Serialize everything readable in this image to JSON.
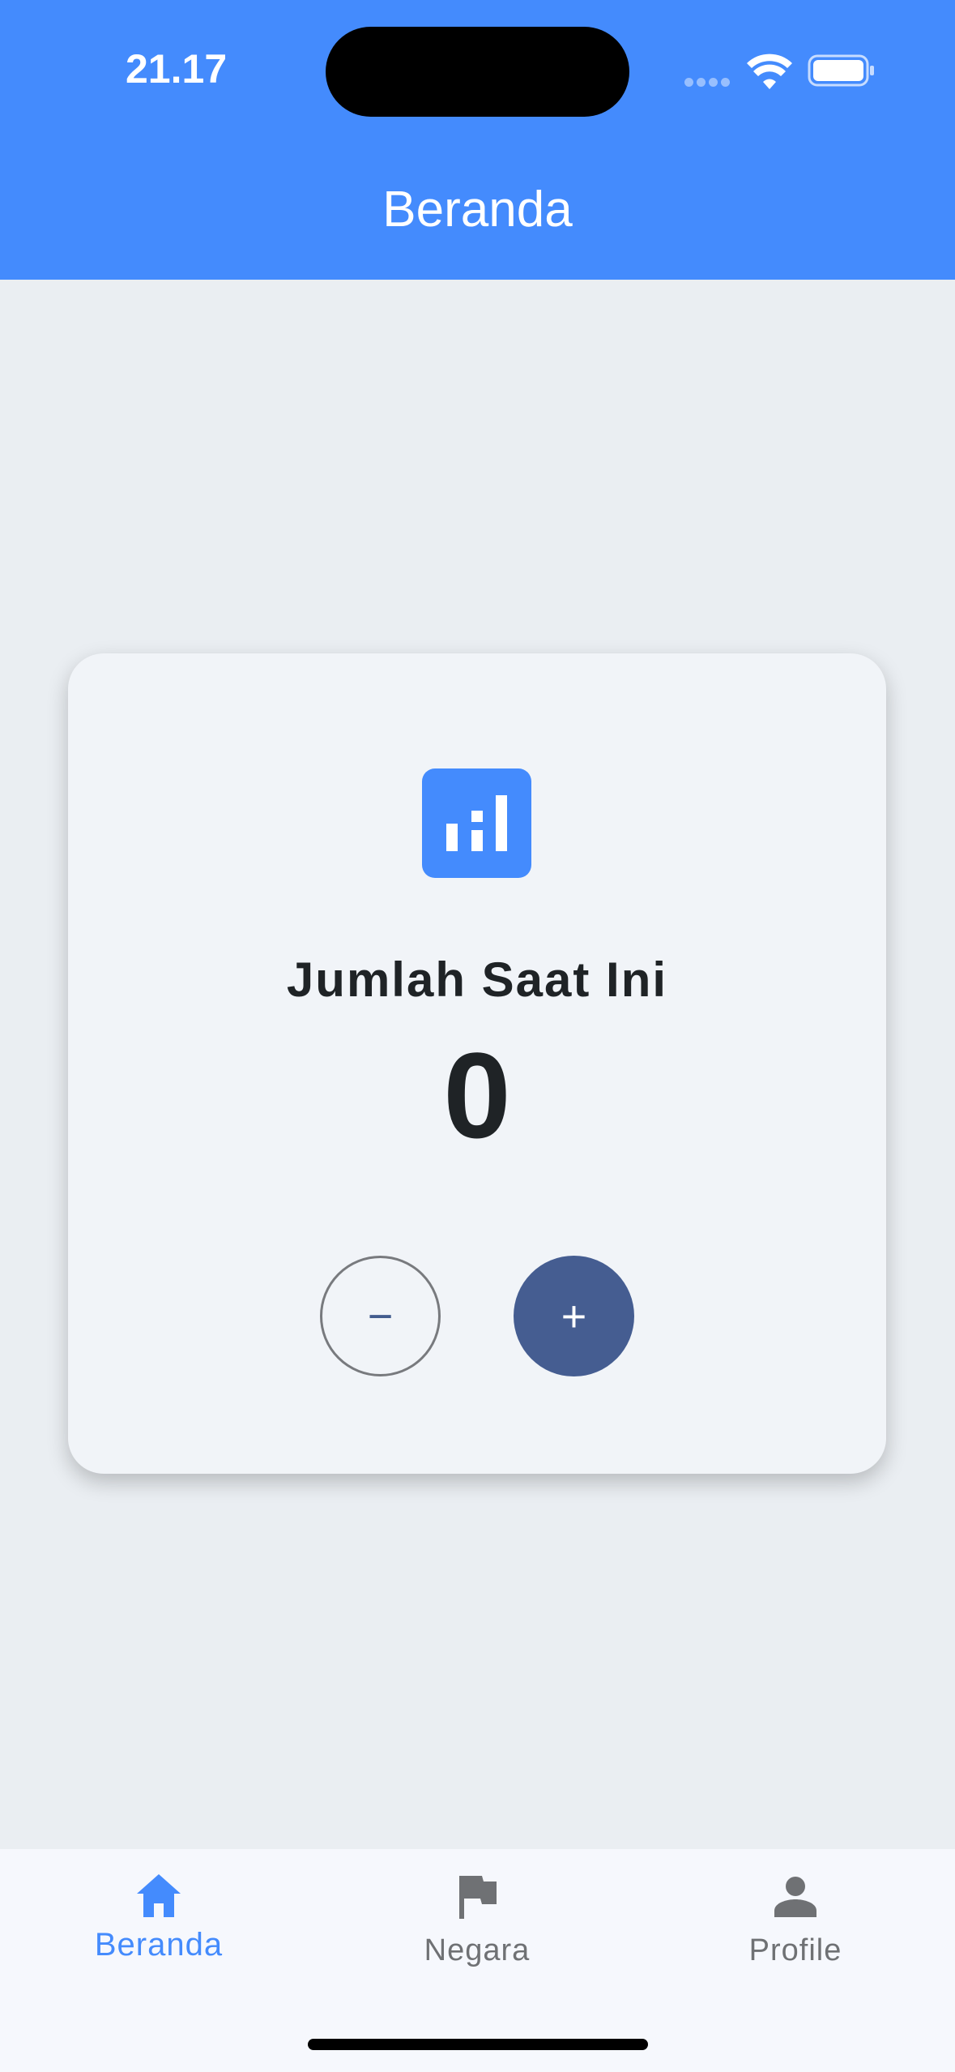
{
  "status_bar": {
    "time": "21.17"
  },
  "header": {
    "title": "Beranda"
  },
  "counter_card": {
    "icon": "bar-chart-icon",
    "label": "Jumlah Saat Ini",
    "value": "0",
    "decrement_label": "−",
    "increment_label": "+"
  },
  "bottom_nav": {
    "items": [
      {
        "label": "Beranda",
        "icon": "home-icon",
        "active": true
      },
      {
        "label": "Negara",
        "icon": "flag-icon",
        "active": false
      },
      {
        "label": "Profile",
        "icon": "person-icon",
        "active": false
      }
    ]
  },
  "colors": {
    "primary": "#448bfd",
    "accent_button": "#455d91",
    "background": "#eaeef2",
    "card": "#f1f4f8",
    "inactive_nav": "#6f7174"
  }
}
